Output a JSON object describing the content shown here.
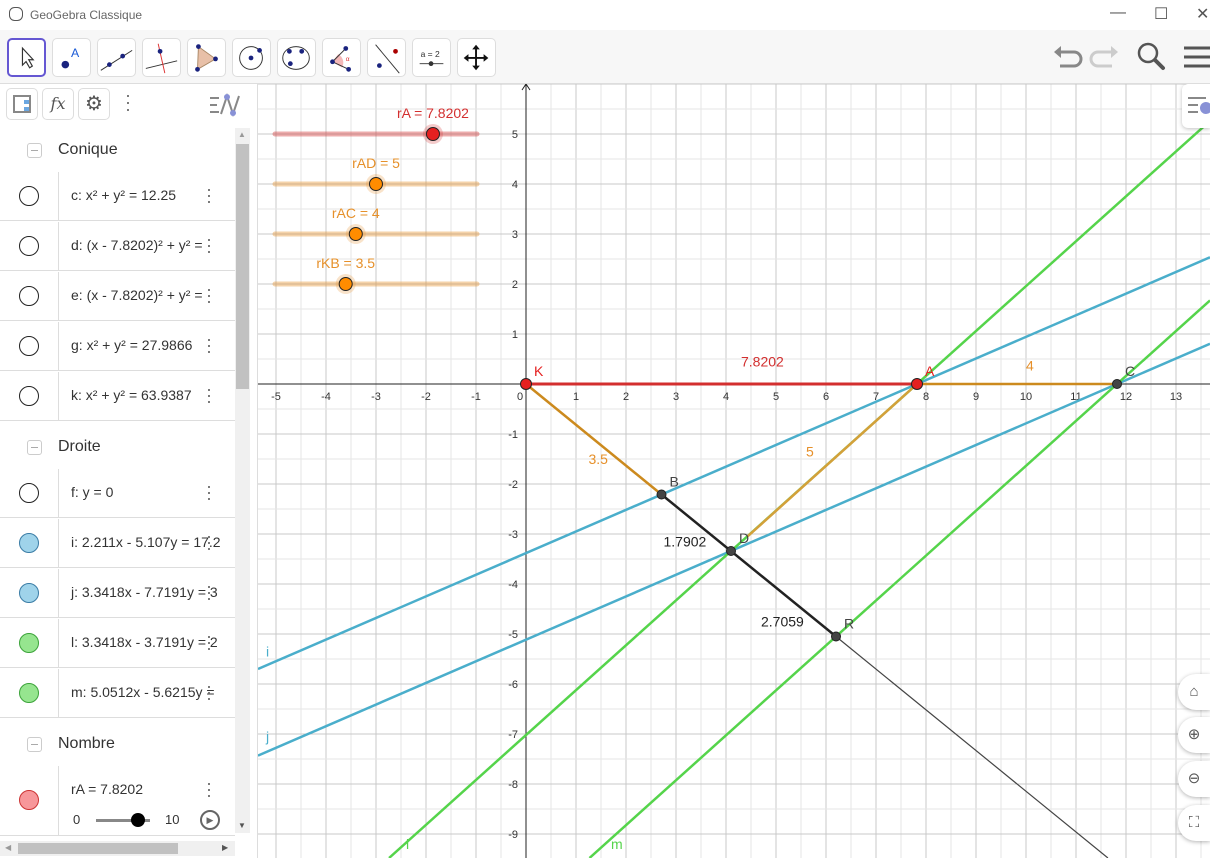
{
  "window": {
    "title": "GeoGebra Classique",
    "minimize": "—",
    "maximize": "☐",
    "close": "✕"
  },
  "toolbar": {
    "tools": [
      "move-tool",
      "point-tool",
      "line-tool",
      "perpendicular-line-tool",
      "polygon-tool",
      "circle-center-point-tool",
      "conic-five-points-tool",
      "angle-tool",
      "reflect-about-line-tool",
      "slider-tool",
      "move-graphics-view-tool"
    ],
    "slider_tool_label": "a = 2",
    "undo": "undo-icon",
    "redo": "redo-icon",
    "search": "search-icon",
    "menu": "menu-icon"
  },
  "algebra": {
    "header": {
      "fx": "fx"
    },
    "sections": [
      {
        "label": "Conique",
        "rows": [
          {
            "expr": "c: x² + y² = 12.25",
            "color": "#ffffff"
          },
          {
            "expr": "d: (x - 7.8202)² + y² =",
            "color": "#ffffff"
          },
          {
            "expr": "e: (x - 7.8202)² + y² =",
            "color": "#ffffff"
          },
          {
            "expr": "g: x² + y² = 27.9866",
            "color": "#ffffff"
          },
          {
            "expr": "k: x² + y² = 63.9387",
            "color": "#ffffff"
          }
        ]
      },
      {
        "label": "Droite",
        "rows": [
          {
            "expr": "f: y = 0",
            "color": "#ffffff"
          },
          {
            "expr": "i: 2.211x - 5.107y = 17.2",
            "color": "#9fd3ea"
          },
          {
            "expr": "j: 3.3418x - 7.7191y = 3",
            "color": "#9fd3ea"
          },
          {
            "expr": "l: 3.3418x - 3.7191y = 2",
            "color": "#96e58f"
          },
          {
            "expr": "m: 5.0512x - 5.6215y =",
            "color": "#96e58f"
          }
        ]
      },
      {
        "label": "Nombre",
        "rows": [
          {
            "expr": "rA = 7.8202",
            "color": "#f7979a",
            "slider": {
              "min": "0",
              "max": "10",
              "value": 7.8202
            }
          }
        ]
      }
    ]
  },
  "graph": {
    "colors": {
      "red": "#d32f2f",
      "orange": "#cc8a1e",
      "black": "#222222",
      "blue": "#4aaecb",
      "green": "#55d44b",
      "point_red": "#e52020",
      "point_gray": "#444444",
      "label_orange": "#e6902a"
    },
    "x_ticks": [
      "-5",
      "-4",
      "-3",
      "-2",
      "-1",
      "0",
      "1",
      "2",
      "3",
      "4",
      "5",
      "6",
      "7",
      "8",
      "9",
      "10",
      "11",
      "12",
      "13"
    ],
    "y_ticks": [
      "5",
      "4",
      "3",
      "2",
      "1",
      "-1",
      "-2",
      "-3",
      "-4",
      "-5",
      "-6",
      "-7",
      "-8",
      "-9"
    ],
    "sliders": [
      {
        "label": "rA = 7.8202",
        "value": 7.8202,
        "min": 0,
        "max": 10,
        "color": "#d32f2f"
      },
      {
        "label": "rAD = 5",
        "value": 5,
        "min": 0,
        "max": 10,
        "color": "#e6902a"
      },
      {
        "label": "rAC = 4",
        "value": 4,
        "min": 0,
        "max": 10,
        "color": "#e6902a"
      },
      {
        "label": "rKB = 3.5",
        "value": 3.5,
        "min": 0,
        "max": 10,
        "color": "#e6902a"
      }
    ],
    "points": [
      {
        "name": "K",
        "x": 0,
        "y": 0,
        "color": "#e52020"
      },
      {
        "name": "A",
        "x": 7.8202,
        "y": 0,
        "color": "#e52020"
      },
      {
        "name": "C",
        "x": 11.8202,
        "y": 0,
        "color": "#444444"
      },
      {
        "name": "B",
        "x": 2.71,
        "y": -2.21,
        "color": "#444444"
      },
      {
        "name": "D",
        "x": 4.1,
        "y": -3.34,
        "color": "#444444"
      },
      {
        "name": "R",
        "x": 6.2,
        "y": -5.05,
        "color": "#444444"
      }
    ],
    "segment_labels": [
      {
        "text": "7.8202",
        "x": 4.3,
        "y": 0.35,
        "color": "#d32f2f"
      },
      {
        "text": "4",
        "x": 10,
        "y": 0.27,
        "color": "#e6902a"
      },
      {
        "text": "3.5",
        "x": 1.25,
        "y": -1.6,
        "color": "#e6902a"
      },
      {
        "text": "5",
        "x": 5.6,
        "y": -1.45,
        "color": "#e6902a"
      },
      {
        "text": "1.7902",
        "x": 2.75,
        "y": -3.25,
        "color": "#222222"
      },
      {
        "text": "2.7059",
        "x": 4.7,
        "y": -4.85,
        "color": "#222222"
      }
    ],
    "line_labels": [
      {
        "text": "i",
        "x": -5.2,
        "y": -5.45,
        "color": "#4aaecb"
      },
      {
        "text": "j",
        "x": -5.2,
        "y": -7.15,
        "color": "#4aaecb"
      },
      {
        "text": "l",
        "x": -2.4,
        "y": -9.3,
        "color": "#55d44b"
      },
      {
        "text": "m",
        "x": 1.7,
        "y": -9.3,
        "color": "#55d44b"
      }
    ]
  }
}
